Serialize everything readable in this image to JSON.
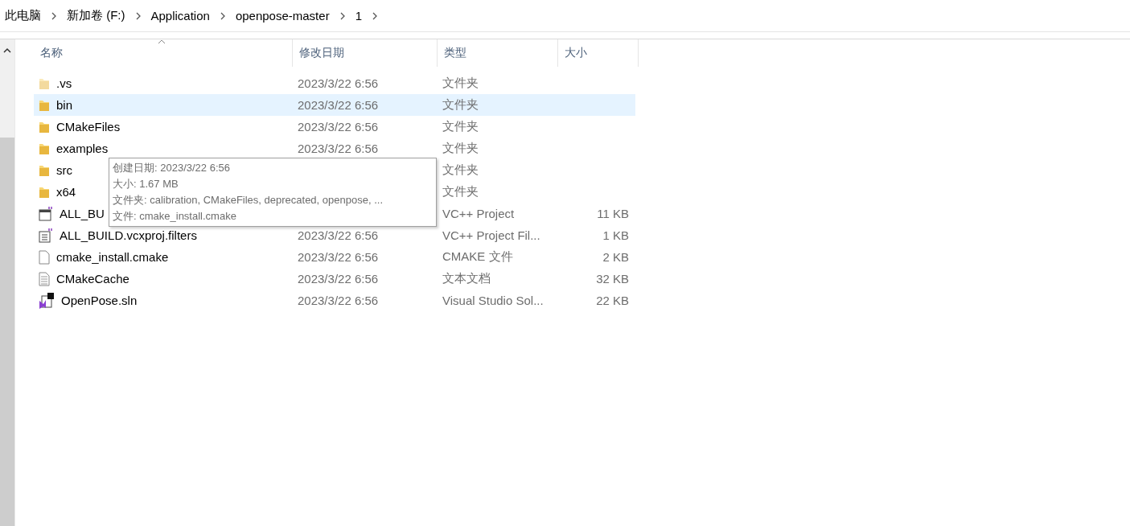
{
  "breadcrumb": [
    "此电脑",
    "新加卷 (F:)",
    "Application",
    "openpose-master",
    "1"
  ],
  "table": {
    "columns": [
      "名称",
      "修改日期",
      "类型",
      "大小"
    ],
    "rows": [
      {
        "kind": "folder",
        "name": ".vs",
        "date": "2023/3/22 6:56",
        "type": "文件夹",
        "selected": false,
        "faded": true
      },
      {
        "kind": "folder",
        "name": "bin",
        "date": "2023/3/22 6:56",
        "type": "文件夹",
        "selected": true,
        "faded": false
      },
      {
        "kind": "folder",
        "name": "CMakeFiles",
        "date": "2023/3/22 6:56",
        "type": "文件夹",
        "selected": false,
        "faded": false
      },
      {
        "kind": "folder",
        "name": "examples",
        "date": "2023/3/22 6:56",
        "type": "文件夹",
        "selected": false,
        "faded": false
      },
      {
        "kind": "folder",
        "name": "src",
        "type": "文件夹",
        "selected": false,
        "faded": false
      },
      {
        "kind": "folder",
        "name": "x64",
        "type": "文件夹",
        "selected": false,
        "faded": false
      },
      {
        "kind": "project",
        "name": "ALL_BU",
        "type": "VC++ Project",
        "size": "11 KB",
        "selected": false,
        "faded": false
      },
      {
        "kind": "filters",
        "name": "ALL_BUILD.vcxproj.filters",
        "date": "2023/3/22 6:56",
        "type": "VC++ Project Fil...",
        "size": "1 KB",
        "selected": false,
        "faded": false
      },
      {
        "kind": "file",
        "name": "cmake_install.cmake",
        "date": "2023/3/22 6:56",
        "type": "CMAKE 文件",
        "size": "2 KB",
        "selected": false,
        "faded": false
      },
      {
        "kind": "text",
        "name": "CMakeCache",
        "date": "2023/3/22 6:56",
        "type": "文本文档",
        "size": "32 KB",
        "selected": false,
        "faded": false
      },
      {
        "kind": "solution",
        "name": "OpenPose.sln",
        "date": "2023/3/22 6:56",
        "type": "Visual Studio Sol...",
        "size": "22 KB",
        "selected": false,
        "faded": false
      }
    ]
  },
  "tooltip": [
    "创建日期: 2023/3/22 6:56",
    "大小: 1.67 MB",
    "文件夹: calibration, CMakeFiles, deprecated, openpose, ...",
    "文件: cmake_install.cmake"
  ]
}
